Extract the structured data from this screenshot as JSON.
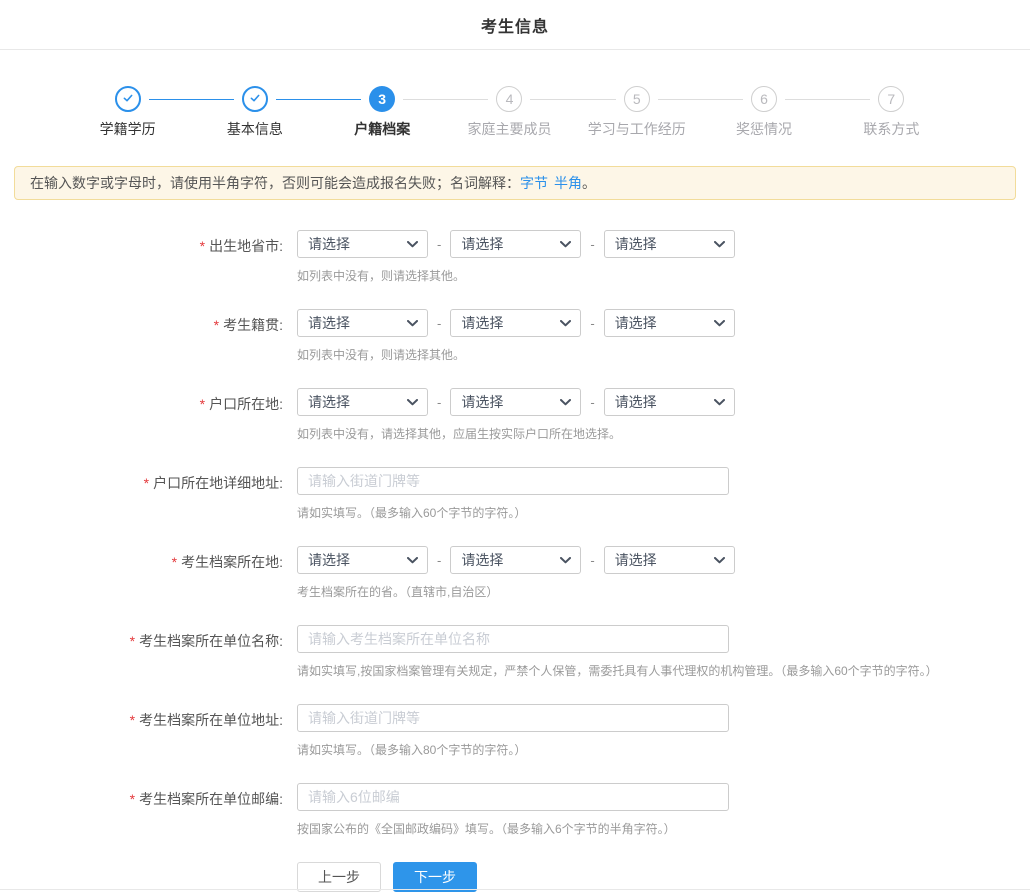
{
  "page": {
    "title": "考生信息"
  },
  "stepper": {
    "steps": [
      {
        "label": "学籍学历",
        "state": "done",
        "icon": "check"
      },
      {
        "label": "基本信息",
        "state": "done",
        "icon": "check"
      },
      {
        "label": "户籍档案",
        "state": "current",
        "number": "3"
      },
      {
        "label": "家庭主要成员",
        "state": "pending",
        "number": "4"
      },
      {
        "label": "学习与工作经历",
        "state": "pending",
        "number": "5"
      },
      {
        "label": "奖惩情况",
        "state": "pending",
        "number": "6"
      },
      {
        "label": "联系方式",
        "state": "pending",
        "number": "7"
      }
    ]
  },
  "notice": {
    "prefix": "在输入数字或字母时，请使用半角字符，否则可能会造成报名失败；名词解释：",
    "link_byte": "字节",
    "link_halfwidth": "半角",
    "suffix": "。"
  },
  "form": {
    "required_mark": "*",
    "select_placeholder": "请选择",
    "separator": "-",
    "rows": [
      {
        "label": "出生地省市:",
        "type": "selects",
        "hint": "如列表中没有，则请选择其他。"
      },
      {
        "label": "考生籍贯:",
        "type": "selects",
        "hint": "如列表中没有，则请选择其他。"
      },
      {
        "label": "户口所在地:",
        "type": "selects",
        "hint": "如列表中没有，请选择其他，应届生按实际户口所在地选择。"
      },
      {
        "label": "户口所在地详细地址:",
        "type": "input",
        "placeholder": "请输入街道门牌等",
        "hint": "请如实填写。（最多输入60个字节的字符。）"
      },
      {
        "label": "考生档案所在地:",
        "type": "selects",
        "hint": "考生档案所在的省。（直辖市,自治区）"
      },
      {
        "label": "考生档案所在单位名称:",
        "type": "input",
        "placeholder": "请输入考生档案所在单位名称",
        "hint": "请如实填写,按国家档案管理有关规定，严禁个人保管，需委托具有人事代理权的机构管理。（最多输入60个字节的字符。）"
      },
      {
        "label": "考生档案所在单位地址:",
        "type": "input",
        "placeholder": "请输入街道门牌等",
        "hint": "请如实填写。（最多输入80个字节的字符。）"
      },
      {
        "label": "考生档案所在单位邮编:",
        "type": "input",
        "placeholder": "请输入6位邮编",
        "hint": "按国家公布的《全国邮政编码》填写。（最多输入6个字节的半角字符。）"
      }
    ]
  },
  "actions": {
    "prev": "上一步",
    "next": "下一步"
  },
  "colors": {
    "accent": "#2b90ea",
    "button_blue": "#2e95ea",
    "notice_bg": "#fdf6e7",
    "notice_border": "#f2dc9a",
    "link": "#2b90ea",
    "required": "#e4393c"
  }
}
